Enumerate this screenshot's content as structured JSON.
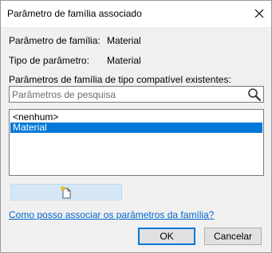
{
  "dialog": {
    "title": "Parâmetro de família associado",
    "close_icon": "close-icon"
  },
  "info": {
    "family_param_label": "Parâmetro de família:",
    "family_param_value": "Material",
    "param_type_label": "Tipo de parâmetro:",
    "param_type_value": "Material"
  },
  "existing": {
    "label": "Parâmetros de família de tipo compatível existentes:"
  },
  "search": {
    "placeholder": "Parâmetros de pesquisa",
    "icon": "magnifier-icon"
  },
  "list": {
    "items": [
      "<nenhum>",
      "Material"
    ],
    "selected_index": 1
  },
  "new_param_button": {
    "icon": "new-parameter-icon"
  },
  "help_link": "Como posso associar os parâmetros da família?",
  "buttons": {
    "ok": "OK",
    "cancel": "Cancelar"
  },
  "colors": {
    "selection": "#0078d7",
    "link": "#0066cc",
    "dialog_bg": "#f0f0f0"
  }
}
